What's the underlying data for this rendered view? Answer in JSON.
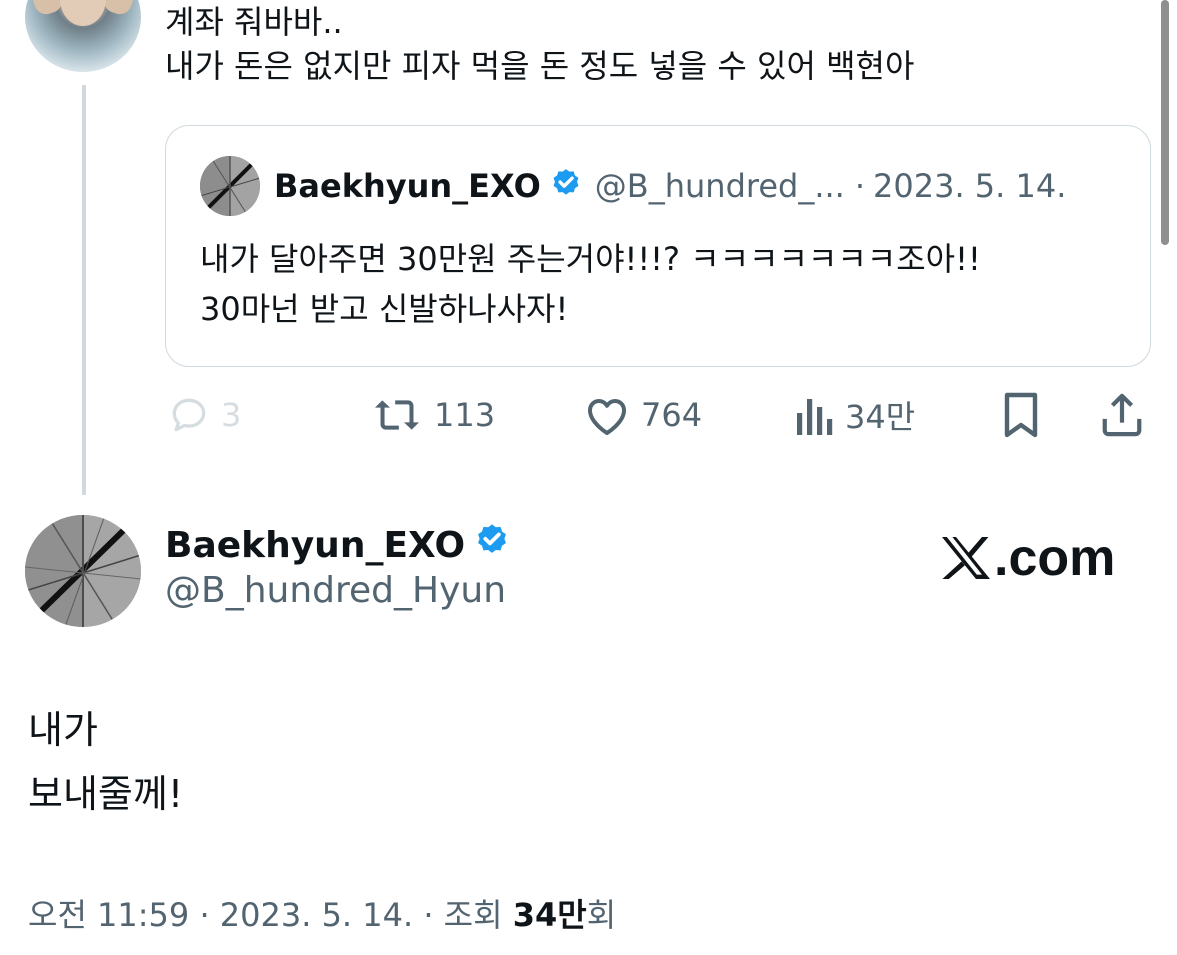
{
  "reply": {
    "lines": [
      "계좌 줘바바..",
      "내가 돈은 없지만 피자 먹을 돈 정도 넣을 수 있어 백현아"
    ]
  },
  "quote": {
    "name": "Baekhyun_EXO",
    "handle": "@B_hundred_...",
    "separator": "·",
    "date": "2023. 5. 14.",
    "lines": [
      "내가 달아주면 30만원 주는거야!!!? ㅋㅋㅋㅋㅋㅋㅋ조아!!",
      "30마넌 받고 신발하나사자!"
    ]
  },
  "actions": {
    "reply_count": "3",
    "retweet_count": "113",
    "like_count": "764",
    "views_count": "34만"
  },
  "tweet": {
    "name": "Baekhyun_EXO",
    "handle": "@B_hundred_Hyun",
    "watermark": ".com",
    "lines": [
      "내가",
      "보내줄께!"
    ]
  },
  "meta": {
    "time_date": "오전 11:59 · 2023. 5. 14. · 조회 ",
    "views_bold": "34만",
    "views_suffix": "회"
  },
  "colors": {
    "text": "#0f1419",
    "secondary": "#536471",
    "verified": "#1d9bf0",
    "border": "#cfd9de"
  }
}
